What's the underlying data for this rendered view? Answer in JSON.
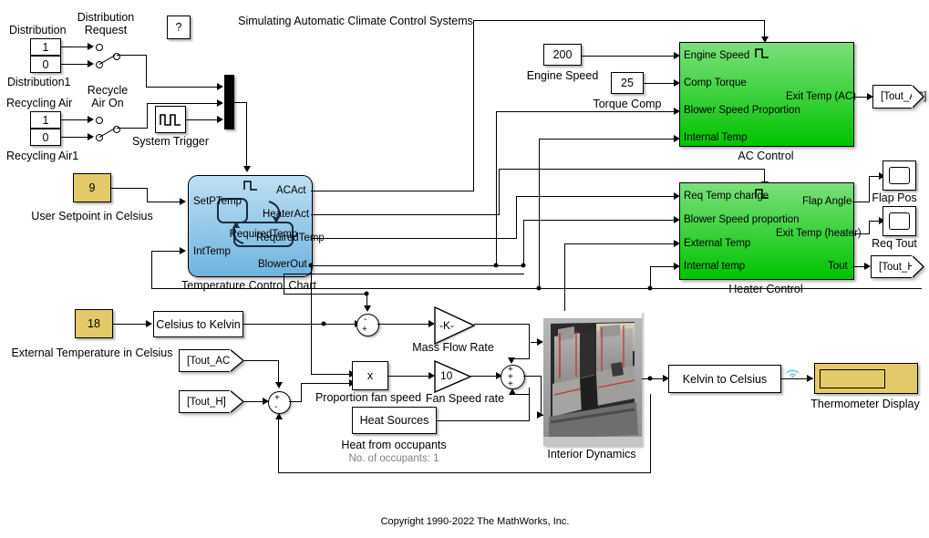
{
  "diagram": {
    "title": "Simulating Automatic Climate Control Systems",
    "copyright": "Copyright 1990-2022 The MathWorks, Inc.",
    "help_block": "?"
  },
  "sources": {
    "distribution_label": "Distribution",
    "distribution_value_top": "1",
    "distribution1_label": "Distribution1",
    "distribution_value_bottom": "0",
    "distribution_request_l1": "Distribution",
    "distribution_request_l2": "Request",
    "recycling_air_label": "Recycling Air",
    "recycling_value_top": "1",
    "recycling_air1_label": "Recycling Air1",
    "recycling_value_bottom": "0",
    "recycle_air_on_l1": "Recycle",
    "recycle_air_on_l2": "Air On",
    "system_trigger_label": "System Trigger",
    "user_setpoint_value": "9",
    "user_setpoint_label": "User Setpoint in Celsius",
    "external_temp_value": "18",
    "external_temp_label": "External Temperature in Celsius",
    "engine_speed_value": "200",
    "engine_speed_label": "Engine Speed",
    "torque_comp_value": "25",
    "torque_comp_label": "Torque Comp"
  },
  "chart": {
    "name": "Temperature Control Chart",
    "inputs": [
      "SetPTemp",
      "IntTemp"
    ],
    "outputs": [
      "ACAct",
      "HeaterAct",
      "RequiredTemp",
      "BlowerOut"
    ],
    "state_label": "RequiredTemp"
  },
  "ac_control": {
    "name": "AC Control",
    "inputs": [
      "Engine Speed",
      "Comp Torque",
      "Blower Speed Proportion",
      "Internal Temp"
    ],
    "outputs": [
      "Exit Temp (AC)"
    ]
  },
  "heater_control": {
    "name": "Heater Control",
    "inputs": [
      "Req Temp change",
      "Blower Speed proportion",
      "External Temp",
      "Internal temp"
    ],
    "outputs": [
      "Flap Angle",
      "Exit Temp (heater)",
      "Tout"
    ]
  },
  "tags": {
    "tout_ac_goto": "[Tout_AC]",
    "tout_h_goto": "[Tout_H]",
    "tout_ac_from": "[Tout_AC]",
    "tout_h_from": "[Tout_H]"
  },
  "scopes": {
    "flap_pos": "Flap Pos",
    "req_tout": "Req Tout"
  },
  "math": {
    "celsius_to_kelvin": "Celsius to Kelvin",
    "kelvin_to_celsius": "Kelvin to Celsius",
    "mass_flow_gain_text": "-K-",
    "mass_flow_label": "Mass Flow Rate",
    "product_text": "x",
    "proportion_fan_speed_label": "Proportion fan speed",
    "fan_speed_gain_text": "10",
    "fan_speed_label": "Fan Speed rate",
    "heat_sources_text": "Heat Sources",
    "heat_sources_label": "Heat from occupants",
    "occupants_note": "No. of occupants: 1",
    "interior_dynamics_label": "Interior Dynamics",
    "thermometer_label": "Thermometer Display",
    "sum1_signs": [
      "+",
      "-"
    ],
    "sum2_signs": [
      "+",
      "-",
      "+"
    ],
    "sum3_signs": [
      "+",
      "+",
      "+"
    ]
  },
  "colors": {
    "constant_yellow": "#E3C969",
    "chart_blue": "#6FB4DF",
    "subsystem_green": "#00C400",
    "wire": "#000000"
  }
}
